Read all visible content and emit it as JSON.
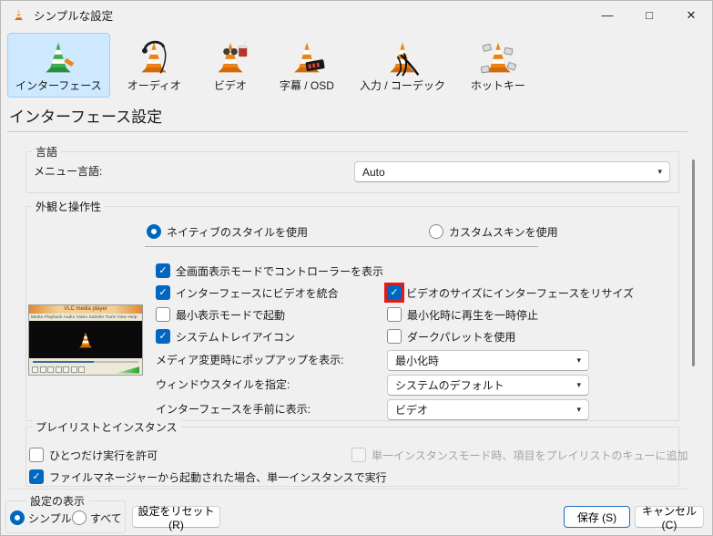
{
  "window": {
    "title": "シンプルな設定"
  },
  "ui": {
    "check_glyph": "✓",
    "caret_glyph": "▾",
    "minimize_glyph": "—",
    "maximize_glyph": "□",
    "close_glyph": "✕"
  },
  "toolbar": [
    {
      "label": "インターフェース",
      "selected": true
    },
    {
      "label": "オーディオ",
      "selected": false
    },
    {
      "label": "ビデオ",
      "selected": false
    },
    {
      "label": "字幕 / OSD",
      "selected": false
    },
    {
      "label": "入力 / コーデック",
      "selected": false
    },
    {
      "label": "ホットキー",
      "selected": false
    }
  ],
  "page_title": "インターフェース設定",
  "language": {
    "title": "言語",
    "menu_language_label": "メニュー言語:",
    "menu_language_value": "Auto"
  },
  "look": {
    "title": "外観と操作性",
    "style_radios": [
      {
        "label": "ネイティブのスタイルを使用",
        "selected": true
      },
      {
        "label": "カスタムスキンを使用",
        "selected": false
      }
    ],
    "checkboxes_left": [
      {
        "label": "全画面表示モードでコントローラーを表示",
        "checked": true
      },
      {
        "label": "インターフェースにビデオを統合",
        "checked": true
      },
      {
        "label": "最小表示モードで起動",
        "checked": false
      },
      {
        "label": "システムトレイアイコン",
        "checked": true
      }
    ],
    "checkboxes_right": [
      {
        "label": "ビデオのサイズにインターフェースをリサイズ",
        "checked": true,
        "highlighted": true
      },
      {
        "label": "最小化時に再生を一時停止",
        "checked": false
      },
      {
        "label": "ダークパレットを使用",
        "checked": false
      }
    ],
    "dropdowns": [
      {
        "label": "メディア変更時にポップアップを表示:",
        "value": "最小化時"
      },
      {
        "label": "ウィンドウスタイルを指定:",
        "value": "システムのデフォルト"
      },
      {
        "label": "インターフェースを手前に表示:",
        "value": "ビデオ"
      }
    ],
    "preview": {
      "title": "VLC media player",
      "menu": "Media Playback Audio Video Subtitle Tools View Help"
    }
  },
  "playlist": {
    "title": "プレイリストとインスタンス",
    "checkbox_allow_one": {
      "label": "ひとつだけ実行を許可",
      "checked": false
    },
    "checkbox_enqueue": {
      "label": "単一インスタンスモード時、項目をプレイリストのキューに追加",
      "checked": false,
      "disabled": true
    },
    "checkbox_filemanager": {
      "label": "ファイルマネージャーから起動された場合、単一インスタンスで実行",
      "checked": true
    }
  },
  "footer": {
    "settings_view_title": "設定の表示",
    "radio_simple": {
      "label": "シンプル",
      "selected": true
    },
    "radio_all": {
      "label": "すべて",
      "selected": false
    },
    "reset_label": "設定をリセット (R)",
    "save_label": "保存 (S)",
    "cancel_label": "キャンセル (C)"
  },
  "colors": {
    "accent_blue": "#0067c0",
    "highlight_red": "#e21a1a",
    "selected_tab_bg": "#cde8ff",
    "selected_tab_border": "#9ed1f5",
    "dialog_bg": "#f0f0f0"
  }
}
